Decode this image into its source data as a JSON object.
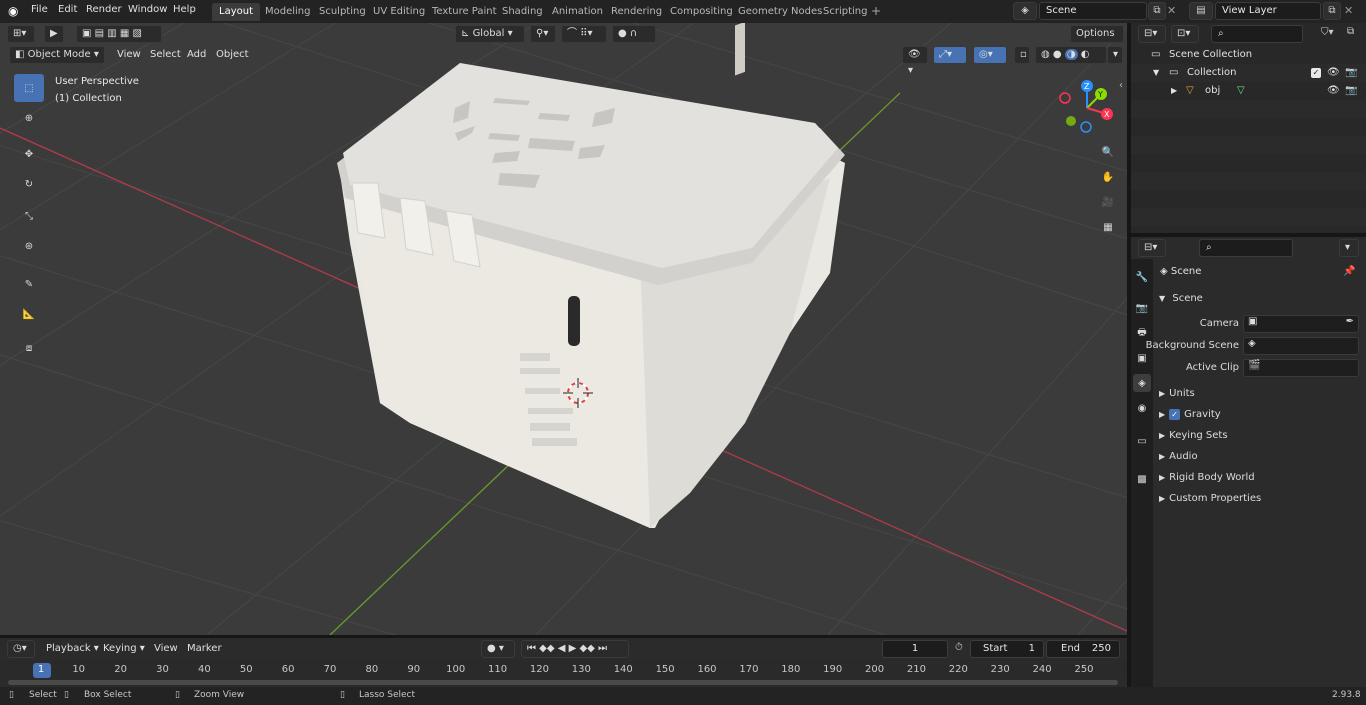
{
  "topbar": {
    "menus": [
      "File",
      "Edit",
      "Render",
      "Window",
      "Help"
    ],
    "workspaces": [
      "Layout",
      "Modeling",
      "Sculpting",
      "UV Editing",
      "Texture Paint",
      "Shading",
      "Animation",
      "Rendering",
      "Compositing",
      "Geometry Nodes",
      "Scripting"
    ],
    "active_workspace": "Layout",
    "add_tab": "+",
    "scene_name": "Scene",
    "view_layer": "View Layer"
  },
  "viewport_header": {
    "transform_orientation": "Global",
    "options_label": "Options",
    "mode": "Object Mode",
    "menus": [
      "View",
      "Select",
      "Add",
      "Object"
    ]
  },
  "viewport": {
    "perspective_label": "User Perspective",
    "collection_label": "(1) Collection",
    "axis_x": "X",
    "axis_y": "Y",
    "axis_z": "Z"
  },
  "outliner": {
    "scene_collection": "Scene Collection",
    "collection": "Collection",
    "object": "obj"
  },
  "properties": {
    "context": "Scene",
    "panel_scene": "Scene",
    "camera_label": "Camera",
    "background_scene_label": "Background Scene",
    "active_clip_label": "Active Clip",
    "subpanels": [
      "Units",
      "Gravity",
      "Keying Sets",
      "Audio",
      "Rigid Body World",
      "Custom Properties"
    ]
  },
  "timeline": {
    "menus": [
      "Playback",
      "Keying",
      "View",
      "Marker"
    ],
    "current_frame": "1",
    "start_label": "Start",
    "start_value": "1",
    "end_label": "End",
    "end_value": "250",
    "ruler": [
      "1",
      "10",
      "20",
      "30",
      "40",
      "50",
      "60",
      "70",
      "80",
      "90",
      "100",
      "110",
      "120",
      "130",
      "140",
      "150",
      "160",
      "170",
      "180",
      "190",
      "200",
      "210",
      "220",
      "230",
      "240",
      "250"
    ]
  },
  "statusbar": {
    "select": "Select",
    "box_select": "Box Select",
    "zoom_view": "Zoom View",
    "lasso_select": "Lasso Select",
    "version": "2.93.8"
  },
  "colors": {
    "accent": "#4772b3",
    "x_axis": "#ff3352",
    "y_axis": "#8bdc00",
    "z_axis": "#2890ff"
  }
}
